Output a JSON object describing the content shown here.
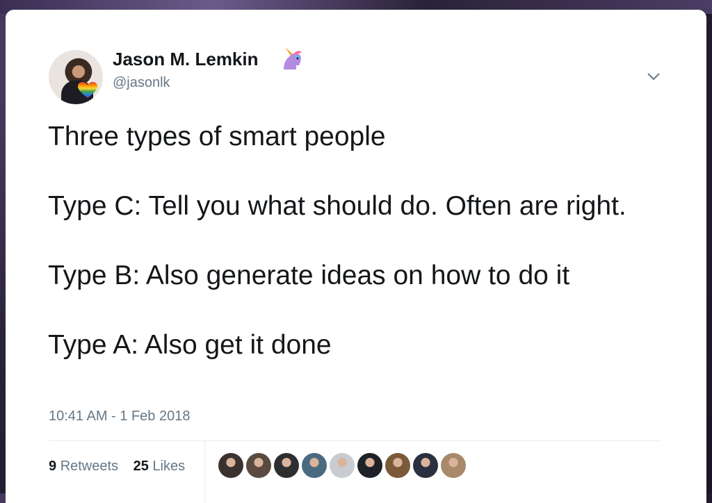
{
  "tweet": {
    "author_name": "Jason M. Lemkin",
    "author_handle": "@jasonlk",
    "text": "Three types of smart people\n\nType C: Tell you what should do.  Often are right.\n\nType B: Also generate ideas on how to do it\n\nType A: Also get it done",
    "timestamp": "10:41 AM - 1 Feb 2018",
    "retweets_count": "9",
    "retweets_label": "Retweets",
    "likes_count": "25",
    "likes_label": "Likes"
  },
  "icons": {
    "author_badge": "unicorn-icon",
    "menu": "chevron-down-icon"
  },
  "likers": [
    {
      "color": "#3b3230"
    },
    {
      "color": "#5a4a40"
    },
    {
      "color": "#2e2e30"
    },
    {
      "color": "#4a6a80"
    },
    {
      "color": "#c8ccd0"
    },
    {
      "color": "#1e2228"
    },
    {
      "color": "#7a5a3a"
    },
    {
      "color": "#2a3040"
    },
    {
      "color": "#a88a6a"
    }
  ],
  "colors": {
    "text": "#14171a",
    "secondary_text": "#657786",
    "divider": "#e6ecf0"
  }
}
